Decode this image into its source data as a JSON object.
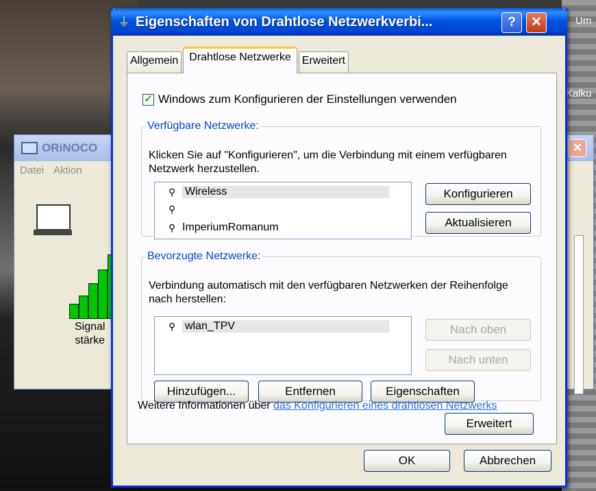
{
  "desktop": {
    "right_labels": [
      "Um",
      "Kalku"
    ]
  },
  "background_window": {
    "title": "ORiNOCO",
    "menu": [
      "Datei",
      "Aktion"
    ],
    "signal_label": [
      "Signal",
      "stärke"
    ]
  },
  "dialog": {
    "title": "Eigenschaften von Drahtlose Netzwerkverbi...",
    "help_button": "?",
    "close_button": "✕",
    "tabs": [
      {
        "label": "Allgemein",
        "active": false
      },
      {
        "label": "Drahtlose Netzwerke",
        "active": true
      },
      {
        "label": "Erweitert",
        "active": false
      }
    ],
    "use_windows_checkbox": {
      "label": "Windows zum Konfigurieren der Einstellungen verwenden",
      "checked": true
    },
    "available": {
      "legend": "Verfügbare Netzwerke:",
      "description": "Klicken Sie auf \"Konfigurieren\", um die Verbindung mit einem verfügbaren Netzwerk herzustellen.",
      "networks": [
        "Wireless",
        "",
        "ImperiumRomanum"
      ],
      "configure_button": "Konfigurieren",
      "refresh_button": "Aktualisieren"
    },
    "preferred": {
      "legend": "Bevorzugte Netzwerke:",
      "description": "Verbindung automatisch mit den verfügbaren Netzwerken der Reihenfolge nach herstellen:",
      "networks": [
        "wlan_TPV"
      ],
      "move_up_button": "Nach oben",
      "move_down_button": "Nach unten",
      "add_button": "Hinzufügen...",
      "remove_button": "Entfernen",
      "properties_button": "Eigenschaften"
    },
    "info": {
      "prefix": "Weitere Informationen über ",
      "link": "das Konfigurieren eines drahtlosen Netzwerks"
    },
    "advanced_button": "Erweitert",
    "ok_button": "OK",
    "cancel_button": "Abbrechen"
  }
}
